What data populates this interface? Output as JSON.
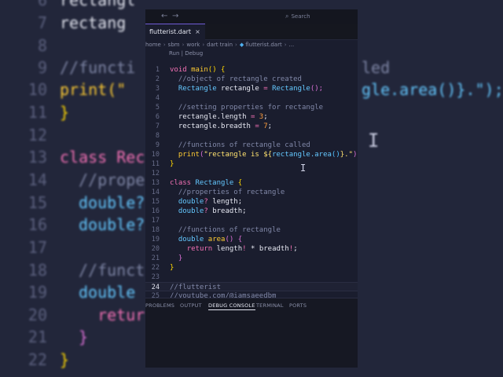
{
  "background": {
    "lines": [
      {
        "num": "6",
        "code": "rectangl",
        "right": ""
      },
      {
        "num": "7",
        "code": "rectang",
        "right": ""
      },
      {
        "num": "8",
        "code": "",
        "right": ""
      },
      {
        "num": "9",
        "code": "//functi",
        "right": "led"
      },
      {
        "num": "10",
        "code": "print(\"",
        "right": "gle.area()}.\");"
      },
      {
        "num": "11",
        "code": "}",
        "right": ""
      },
      {
        "num": "12",
        "code": "",
        "right": ""
      },
      {
        "num": "13",
        "code": "class Rec",
        "right": ""
      },
      {
        "num": "14",
        "code": "//proper",
        "right": ""
      },
      {
        "num": "15",
        "code": "double?",
        "right": ""
      },
      {
        "num": "16",
        "code": "double?",
        "right": ""
      },
      {
        "num": "17",
        "code": "",
        "right": ""
      },
      {
        "num": "18",
        "code": "//funct",
        "right": ""
      },
      {
        "num": "19",
        "code": "double",
        "right": ""
      },
      {
        "num": "20",
        "code": "  retur",
        "right": ""
      },
      {
        "num": "21",
        "code": "}",
        "right": ""
      },
      {
        "num": "22",
        "code": "}",
        "right": ""
      }
    ]
  },
  "titlebar": {
    "back_icon": "←",
    "forward_icon": "→",
    "search_icon": "⌕",
    "search_placeholder": "Search"
  },
  "tab": {
    "label": "flutterist.dart",
    "close_icon": "×"
  },
  "breadcrumb": {
    "items": [
      "home",
      "sbm",
      "work",
      "dart train",
      "flutterist.dart",
      "..."
    ],
    "separator": "›"
  },
  "codelens": "Run | Debug",
  "editor": {
    "current_line": 24,
    "lines": [
      {
        "n": "1"
      },
      {
        "n": "2"
      },
      {
        "n": "3"
      },
      {
        "n": "4"
      },
      {
        "n": "5"
      },
      {
        "n": "6"
      },
      {
        "n": "7"
      },
      {
        "n": "8"
      },
      {
        "n": "9"
      },
      {
        "n": "10"
      },
      {
        "n": "11"
      },
      {
        "n": "12"
      },
      {
        "n": "13"
      },
      {
        "n": "14"
      },
      {
        "n": "15"
      },
      {
        "n": "16"
      },
      {
        "n": "17"
      },
      {
        "n": "18"
      },
      {
        "n": "19"
      },
      {
        "n": "20"
      },
      {
        "n": "21"
      },
      {
        "n": "22"
      },
      {
        "n": "23"
      },
      {
        "n": "24"
      },
      {
        "n": "25"
      }
    ],
    "code": {
      "l1": [
        "void",
        "main",
        "()",
        " {"
      ],
      "l2": "//object of rectangle created",
      "l3": [
        "Rectangle",
        " rectangle ",
        "=",
        " Rectangle",
        "();"
      ],
      "l5": "//setting properties for rectangle",
      "l6": [
        "rectangle.length ",
        "=",
        " 3",
        ";"
      ],
      "l7": [
        "rectangle.breadth ",
        "=",
        " 7",
        ";"
      ],
      "l9": "//functions of rectangle called",
      "l10": [
        "print",
        "(",
        "\"rectangle is ${",
        "rectangle.area",
        "()",
        "}.\"",
        ");"
      ],
      "l11": "}",
      "l13": [
        "class",
        " Rectangle",
        " {"
      ],
      "l14": "//properties of rectangle",
      "l15": [
        "double",
        "?",
        " length;"
      ],
      "l16": [
        "double",
        "?",
        " breadth;"
      ],
      "l18": "//functions of rectangle",
      "l19": [
        "double",
        " area",
        "()",
        " {"
      ],
      "l20": [
        "return",
        " length",
        "!",
        " * ",
        "breadth",
        "!",
        ";"
      ],
      "l21": "}",
      "l22": "}",
      "l24": "//flutterist",
      "l25": "//youtube.com/@iamsaeedbm"
    }
  },
  "panel": {
    "tabs": [
      "PROBLEMS",
      "OUTPUT",
      "DEBUG CONSOLE",
      "TERMINAL",
      "PORTS"
    ],
    "active": "DEBUG CONSOLE"
  },
  "colors": {
    "keyword": "#f471b5",
    "function": "#ffcc33",
    "type": "#64c8ff",
    "comment": "#8188a8",
    "string": "#ffe270",
    "number": "#ff9d3d",
    "background": "#1a1d2e"
  }
}
